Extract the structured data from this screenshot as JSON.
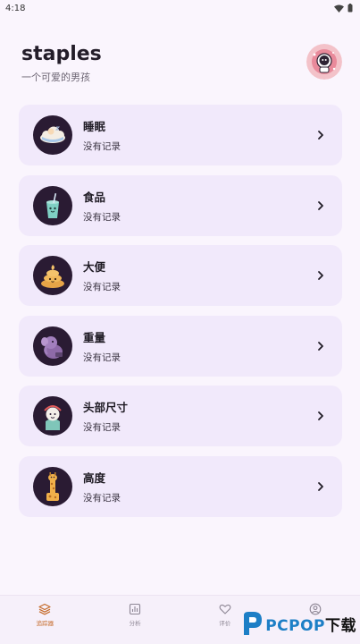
{
  "status_bar": {
    "time": "4:18"
  },
  "header": {
    "title": "staples",
    "subtitle": "一个可爱的男孩"
  },
  "trackers": [
    {
      "label": "睡眠",
      "status": "没有记录",
      "icon": "sleep-cloud-icon"
    },
    {
      "label": "食品",
      "status": "没有记录",
      "icon": "food-drink-icon"
    },
    {
      "label": "大便",
      "status": "没有记录",
      "icon": "poop-icon"
    },
    {
      "label": "重量",
      "status": "没有记录",
      "icon": "weight-elephant-icon"
    },
    {
      "label": "头部尺寸",
      "status": "没有记录",
      "icon": "head-size-icon"
    },
    {
      "label": "高度",
      "status": "没有记录",
      "icon": "height-giraffe-icon"
    }
  ],
  "bottom_nav": [
    {
      "label": "追踪器",
      "icon": "layers-icon",
      "active": true
    },
    {
      "label": "分析",
      "icon": "bar-chart-icon",
      "active": false
    },
    {
      "label": "评价",
      "icon": "heart-icon",
      "active": false
    },
    {
      "label": "",
      "icon": "profile-icon",
      "active": false
    }
  ],
  "watermark": {
    "brand": "PCPOP",
    "suffix": "下载"
  },
  "colors": {
    "accent": "#c56a29",
    "card_bg": "#f1e9fb",
    "page_bg": "#faf5fd"
  }
}
